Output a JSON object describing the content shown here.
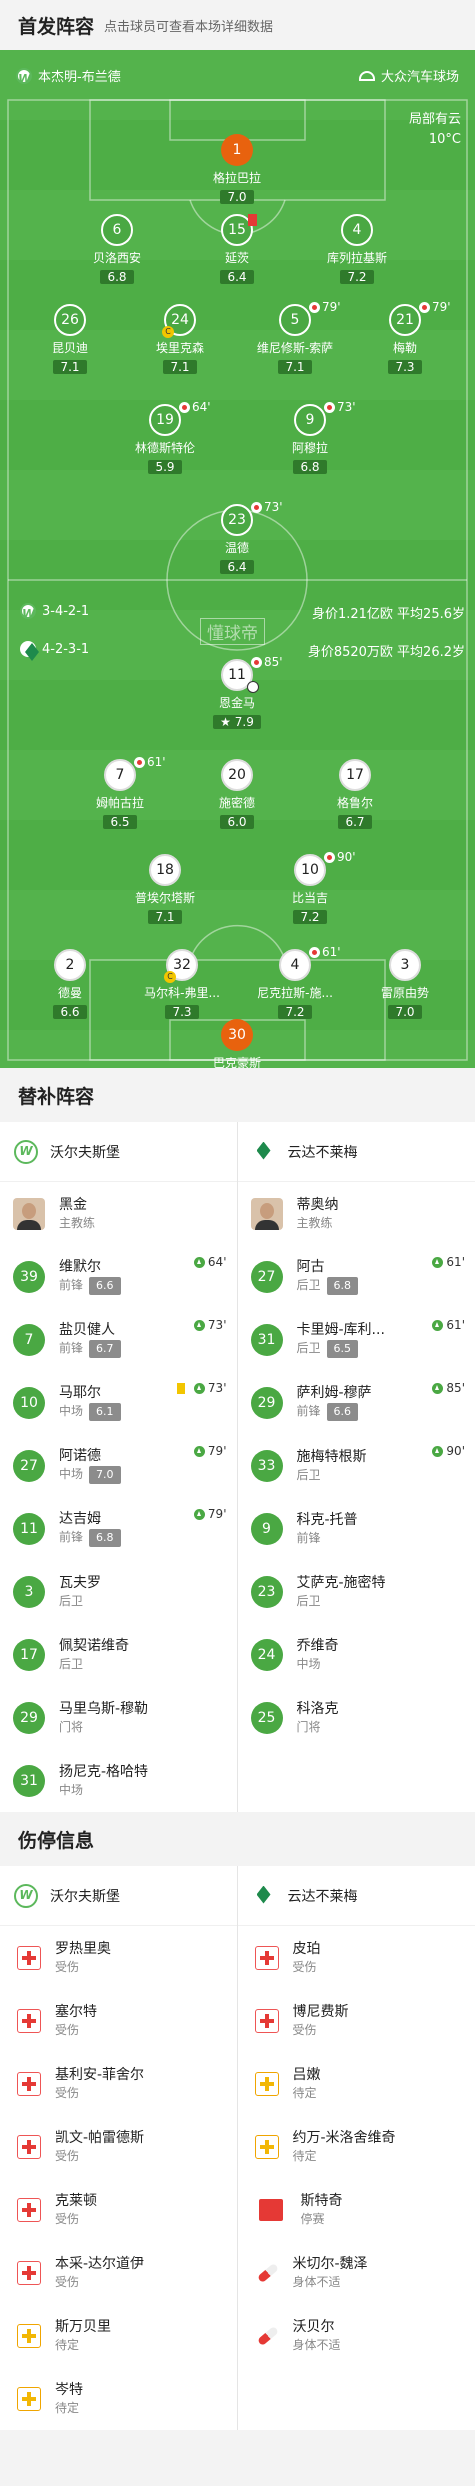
{
  "header": {
    "title": "首发阵容",
    "subtitle": "点击球员可查看本场详细数据"
  },
  "pitch": {
    "home_team": "本杰明-布兰德",
    "venue": "大众汽车球场",
    "weather": "局部有云",
    "temperature": "10°C",
    "watermark": "懂球帝",
    "home_formation": "3-4-2-1",
    "home_value": "身价1.21亿欧",
    "home_age": "平均25.6岁",
    "away_formation": "4-2-3-1",
    "away_value": "身价8520万欧",
    "away_age": "平均26.2岁",
    "players": [
      {
        "num": "1",
        "name": "格拉巴拉",
        "rating": "7.0",
        "style": "orange"
      },
      {
        "num": "6",
        "name": "贝洛西安",
        "rating": "6.8"
      },
      {
        "num": "15",
        "name": "延茨",
        "rating": "6.4",
        "card": "red"
      },
      {
        "num": "4",
        "name": "库列拉基斯",
        "rating": "7.2"
      },
      {
        "num": "26",
        "name": "昆贝迪",
        "rating": "7.1"
      },
      {
        "num": "24",
        "name": "埃里克森",
        "rating": "7.1",
        "captain": "C"
      },
      {
        "num": "5",
        "name": "维尼修斯-索萨",
        "rating": "7.1",
        "sub": "79'"
      },
      {
        "num": "21",
        "name": "梅勒",
        "rating": "7.3",
        "sub": "79'"
      },
      {
        "num": "19",
        "name": "林德斯特伦",
        "rating": "5.9",
        "sub": "64'"
      },
      {
        "num": "9",
        "name": "阿穆拉",
        "rating": "6.8",
        "sub": "73'"
      },
      {
        "num": "23",
        "name": "温德",
        "rating": "6.4",
        "sub": "73'"
      },
      {
        "num": "11",
        "name": "恩金马",
        "rating": "7.9",
        "style": "white",
        "sub": "85'",
        "goal": true
      },
      {
        "num": "7",
        "name": "姆帕古拉",
        "rating": "6.5",
        "style": "white",
        "sub": "61'"
      },
      {
        "num": "20",
        "name": "施密德",
        "rating": "6.0",
        "style": "white"
      },
      {
        "num": "17",
        "name": "格鲁尔",
        "rating": "6.7",
        "style": "white"
      },
      {
        "num": "18",
        "name": "普埃尔塔斯",
        "rating": "7.1",
        "style": "white"
      },
      {
        "num": "10",
        "name": "比当吉",
        "rating": "7.2",
        "style": "white",
        "sub": "90'"
      },
      {
        "num": "2",
        "name": "德曼",
        "rating": "6.6",
        "style": "white"
      },
      {
        "num": "32",
        "name": "马尔科-弗里...",
        "rating": "7.3",
        "style": "white",
        "captain": "C"
      },
      {
        "num": "4",
        "name": "尼克拉斯-施...",
        "rating": "7.2",
        "style": "white",
        "sub": "61'"
      },
      {
        "num": "3",
        "name": "雷原由势",
        "rating": "7.0",
        "style": "white"
      },
      {
        "num": "30",
        "name": "巴克豪斯",
        "rating": "7.7",
        "style": "orange"
      }
    ]
  },
  "subs": {
    "title": "替补阵容",
    "home_team": "沃尔夫斯堡",
    "away_team": "云达不莱梅",
    "home_coach": {
      "name": "黑金",
      "role": "主教练"
    },
    "away_coach": {
      "name": "蒂奥纳",
      "role": "主教练"
    },
    "home": [
      {
        "num": "39",
        "name": "维默尔",
        "pos": "前锋",
        "rating": "6.6",
        "in": "64'"
      },
      {
        "num": "7",
        "name": "盐贝健人",
        "pos": "前锋",
        "rating": "6.7",
        "in": "73'"
      },
      {
        "num": "10",
        "name": "马耶尔",
        "pos": "中场",
        "rating": "6.1",
        "in": "73'",
        "yellow": true
      },
      {
        "num": "27",
        "name": "阿诺德",
        "pos": "中场",
        "rating": "7.0",
        "in": "79'"
      },
      {
        "num": "11",
        "name": "达吉姆",
        "pos": "前锋",
        "rating": "6.8",
        "in": "79'"
      },
      {
        "num": "3",
        "name": "瓦夫罗",
        "pos": "后卫"
      },
      {
        "num": "17",
        "name": "佩契诺维奇",
        "pos": "后卫"
      },
      {
        "num": "29",
        "name": "马里乌斯-穆勒",
        "pos": "门将"
      },
      {
        "num": "31",
        "name": "扬尼克-格哈特",
        "pos": "中场"
      }
    ],
    "away": [
      {
        "num": "27",
        "name": "阿古",
        "pos": "后卫",
        "rating": "6.8",
        "in": "61'"
      },
      {
        "num": "31",
        "name": "卡里姆-库利...",
        "pos": "后卫",
        "rating": "6.5",
        "in": "61'"
      },
      {
        "num": "29",
        "name": "萨利姆-穆萨",
        "pos": "前锋",
        "rating": "6.6",
        "in": "85'"
      },
      {
        "num": "33",
        "name": "施梅特根斯",
        "pos": "后卫",
        "in": "90'"
      },
      {
        "num": "9",
        "name": "科克-托普",
        "pos": "前锋"
      },
      {
        "num": "23",
        "name": "艾萨克-施密特",
        "pos": "后卫"
      },
      {
        "num": "24",
        "name": "乔维奇",
        "pos": "中场"
      },
      {
        "num": "25",
        "name": "科洛克",
        "pos": "门将"
      }
    ]
  },
  "injuries": {
    "title": "伤停信息",
    "home": [
      {
        "name": "罗热里奥",
        "status": "受伤",
        "type": "inj"
      },
      {
        "name": "塞尔特",
        "status": "受伤",
        "type": "inj"
      },
      {
        "name": "基利安-菲舍尔",
        "status": "受伤",
        "type": "inj"
      },
      {
        "name": "凯文-帕雷德斯",
        "status": "受伤",
        "type": "inj"
      },
      {
        "name": "克莱顿",
        "status": "受伤",
        "type": "inj"
      },
      {
        "name": "本采-达尔道伊",
        "status": "受伤",
        "type": "inj"
      },
      {
        "name": "斯万贝里",
        "status": "待定",
        "type": "dbt"
      },
      {
        "name": "岑特",
        "status": "待定",
        "type": "dbt"
      }
    ],
    "away": [
      {
        "name": "皮珀",
        "status": "受伤",
        "type": "inj"
      },
      {
        "name": "博尼费斯",
        "status": "受伤",
        "type": "inj"
      },
      {
        "name": "吕嫩",
        "status": "待定",
        "type": "dbt"
      },
      {
        "name": "约万-米洛舍维奇",
        "status": "待定",
        "type": "dbt"
      },
      {
        "name": "斯特奇",
        "status": "停赛",
        "type": "sus"
      },
      {
        "name": "米切尔-魏泽",
        "status": "身体不适",
        "type": "ill"
      },
      {
        "name": "沃贝尔",
        "status": "身体不适",
        "type": "ill"
      }
    ]
  }
}
